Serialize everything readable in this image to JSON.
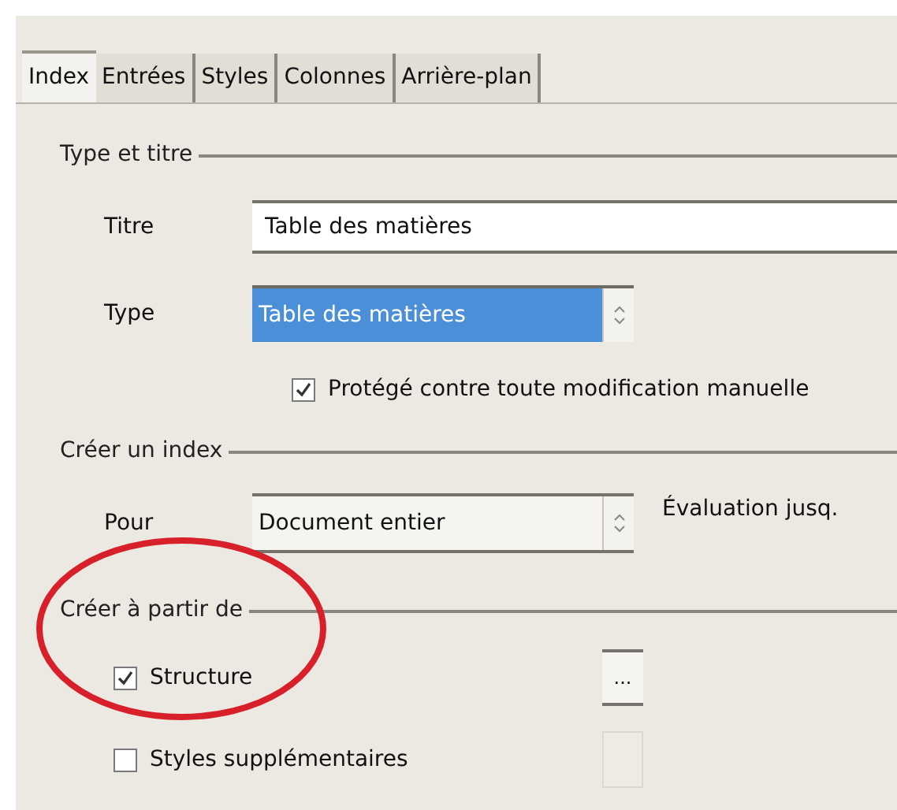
{
  "tabs": [
    {
      "label": "Index",
      "selected": true
    },
    {
      "label": "Entrées",
      "selected": false
    },
    {
      "label": "Styles",
      "selected": false
    },
    {
      "label": "Colonnes",
      "selected": false
    },
    {
      "label": "Arrière-plan",
      "selected": false
    }
  ],
  "type_and_title": {
    "heading": "Type et titre",
    "title_label": "Titre",
    "title_value": "Table des matières",
    "type_label": "Type",
    "type_value": "Table des matières",
    "protected": {
      "label": "Protégé contre toute modification manuelle",
      "checked": true
    }
  },
  "create_index": {
    "heading": "Créer un index",
    "for_label": "Pour",
    "for_value": "Document entier",
    "evaluation_label": "Évaluation jusq."
  },
  "create_from": {
    "heading": "Créer à partir de",
    "options": [
      {
        "label": "Structure",
        "checked": true,
        "button": {
          "label": "...",
          "disabled": false
        }
      },
      {
        "label": "Styles supplémentaires",
        "checked": false,
        "button": {
          "disabled": true
        }
      }
    ]
  }
}
